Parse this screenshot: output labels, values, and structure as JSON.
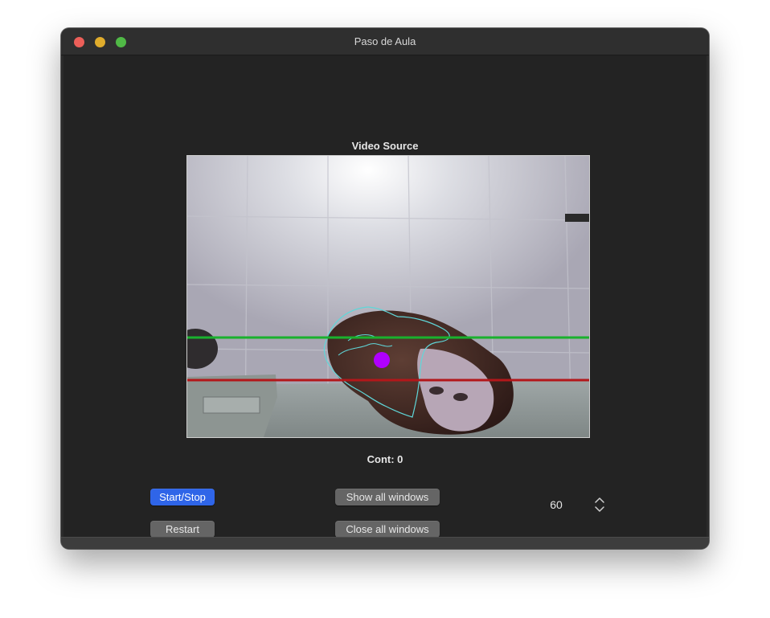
{
  "window": {
    "title": "Paso de Aula"
  },
  "video": {
    "label": "Video Source"
  },
  "counter": {
    "label": "Cont: 0"
  },
  "buttons": {
    "start_stop": "Start/Stop",
    "restart": "Restart",
    "show_all": "Show all windows",
    "close_all": "Close all windows"
  },
  "stepper": {
    "value": "60"
  },
  "colors": {
    "accent": "#2f65e8",
    "upper_line": "#19b12d",
    "lower_line": "#b3171a",
    "contour": "#5fd7d9",
    "centroid": "#b000ff"
  },
  "icons": {
    "close": "close-light",
    "minimize": "minimize-light",
    "maximize": "maximize-light",
    "stepper": "chevron-up-down-icon"
  }
}
